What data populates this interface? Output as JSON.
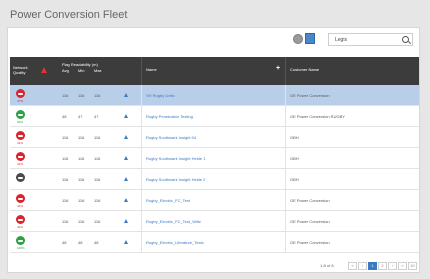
{
  "page": {
    "title": "Power Conversion Fleet"
  },
  "toolbar": {
    "search_value": "Legis",
    "icons": [
      "globe-icon",
      "map-icon",
      "search-icon"
    ]
  },
  "grid": {
    "columns": {
      "quality": "Network Quality",
      "flag_group": "Flag Readability (m)",
      "flag_min": "Avg",
      "flag_avg": "Min",
      "flag_max": "Max",
      "name": "Name",
      "name_sort": "+",
      "customer": "Customer Name"
    },
    "rows": [
      {
        "quality": "bad",
        "quality_label": "47%",
        "v1": "116",
        "v2": "116",
        "v3": "116",
        "name": "SH Rugby Units",
        "customer": "GE Power Conversion",
        "selected": true
      },
      {
        "quality": "good",
        "quality_label": "94%",
        "v1": "48",
        "v2": "47",
        "v3": "47",
        "name": "Rugby Penetration Testing",
        "customer": "GE Power Conversion RUGBY",
        "selected": false
      },
      {
        "quality": "bad",
        "quality_label": "41%",
        "v1": "116",
        "v2": "116",
        "v3": "116",
        "name": "Rugby Southwark Insight 04",
        "customer": "GBH",
        "selected": false
      },
      {
        "quality": "bad",
        "quality_label": "41%",
        "v1": "116",
        "v2": "116",
        "v3": "116",
        "name": "Rugby Southwark Insight Heide 1",
        "customer": "GBH",
        "selected": false
      },
      {
        "quality": "neutral",
        "quality_label": "",
        "v1": "116",
        "v2": "116",
        "v3": "116",
        "name": "Rugby Southwark Insight Heide 2",
        "customer": "GBH",
        "selected": false
      },
      {
        "quality": "bad",
        "quality_label": "41%",
        "v1": "116",
        "v2": "116",
        "v3": "116",
        "name": "Rugby_Electric_FC_Test",
        "customer": "GE Power Conversion",
        "selected": false
      },
      {
        "quality": "bad",
        "quality_label": "41%",
        "v1": "116",
        "v2": "116",
        "v3": "116",
        "name": "Rugby_Electric_FC_Test_Wiltz",
        "customer": "GE Power Conversion",
        "selected": false
      },
      {
        "quality": "good",
        "quality_label": "100%",
        "v1": "48",
        "v2": "48",
        "v3": "48",
        "name": "Rugby_Electric_Literature_Tests",
        "customer": "GE Power Conversion",
        "selected": false
      }
    ]
  },
  "pager": {
    "info": "1-8 of 8",
    "buttons": [
      "«",
      "‹",
      "1",
      "2",
      "›",
      "»",
      "10"
    ],
    "active_page": "1"
  }
}
